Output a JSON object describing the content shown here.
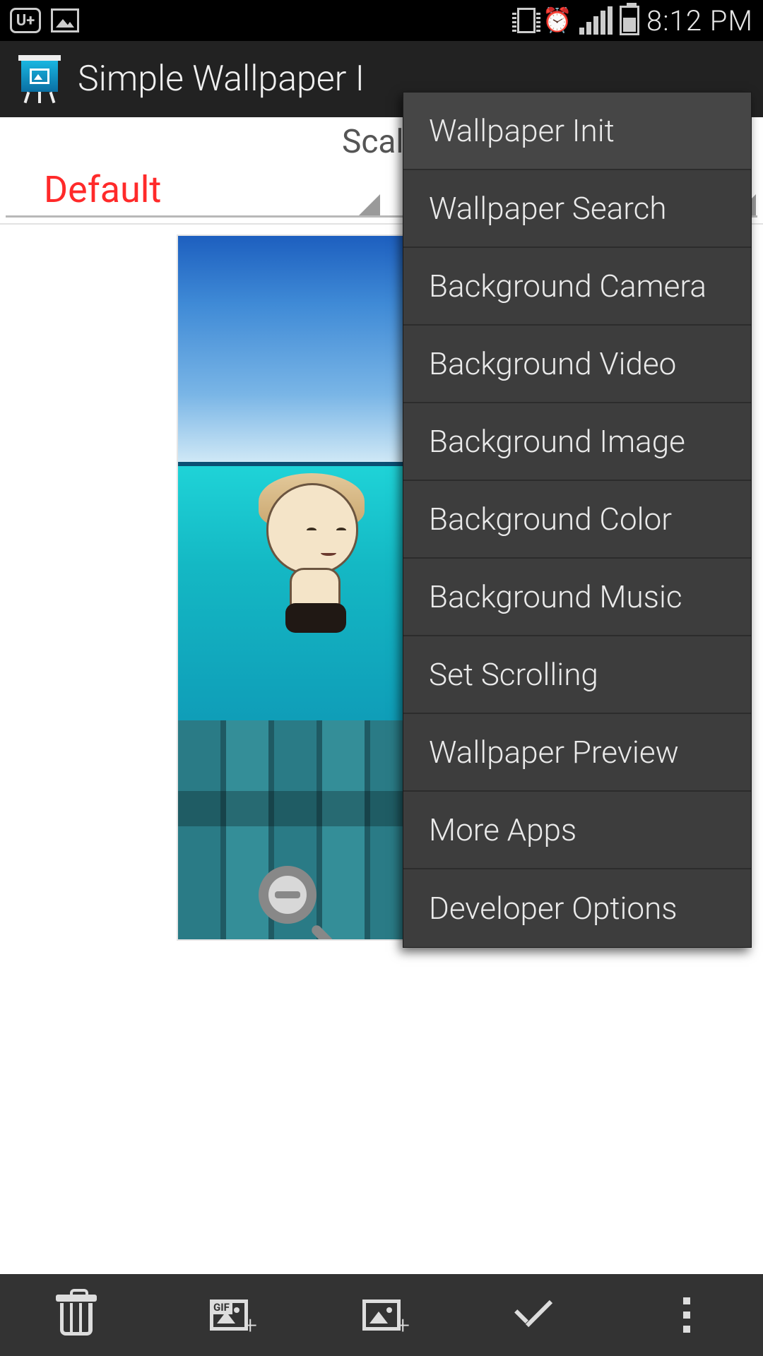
{
  "status_bar": {
    "carrier_badge": "U+",
    "time": "8:12 PM"
  },
  "app_bar": {
    "title": "Simple Wallpaper I"
  },
  "scale_row": {
    "label": "Scale",
    "spinner_left": "Default",
    "spinner_right": ""
  },
  "overflow_menu": {
    "items": [
      "Wallpaper Init",
      "Wallpaper Search",
      "Background Camera",
      "Background Video",
      "Background Image",
      "Background Color",
      "Background Music",
      "Set Scrolling",
      "Wallpaper Preview",
      "More Apps",
      "Developer Options"
    ]
  },
  "bottom_bar": {
    "actions": {
      "delete": "delete",
      "add_gif": "add-gif",
      "add_image": "add-image",
      "confirm": "confirm",
      "overflow": "overflow"
    }
  },
  "colors": {
    "accent_red": "#ff2a2a",
    "menu_bg": "#3d3d3d",
    "appbar_bg": "#222222",
    "bottombar_bg": "#333333"
  }
}
